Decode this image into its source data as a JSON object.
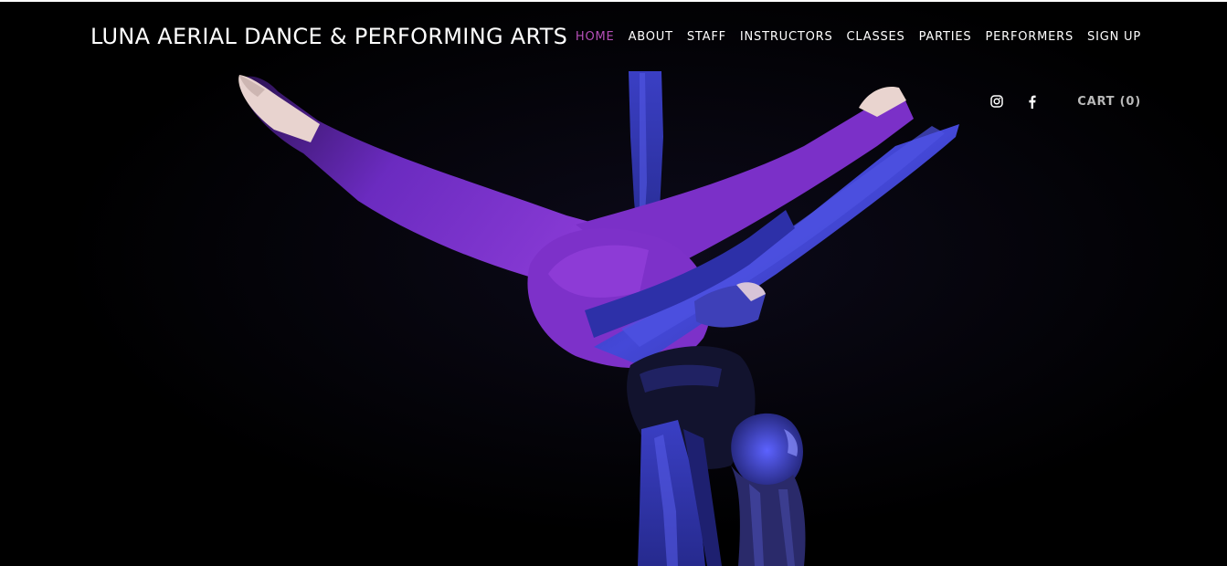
{
  "site": {
    "title": "LUNA AERIAL DANCE & PERFORMING ARTS"
  },
  "nav": {
    "items": [
      {
        "label": "HOME",
        "active": true
      },
      {
        "label": "ABOUT",
        "active": false
      },
      {
        "label": "STAFF",
        "active": false
      },
      {
        "label": "INSTRUCTORS",
        "active": false
      },
      {
        "label": "CLASSES",
        "active": false
      },
      {
        "label": "PARTIES",
        "active": false
      },
      {
        "label": "PERFORMERS",
        "active": false
      },
      {
        "label": "SIGN UP",
        "active": false
      }
    ]
  },
  "utility": {
    "social": [
      {
        "icon": "instagram-icon"
      },
      {
        "icon": "facebook-icon"
      }
    ],
    "cart_label": "CART (0)"
  },
  "hero": {
    "subject": "aerial silks performer"
  },
  "colors": {
    "background": "#000000",
    "nav_text": "#ffffff",
    "nav_active": "#b54fb8",
    "cart_text": "#b9b9b9",
    "silk_blue": "#3b3fc6",
    "body_purple": "#7a32c4"
  }
}
